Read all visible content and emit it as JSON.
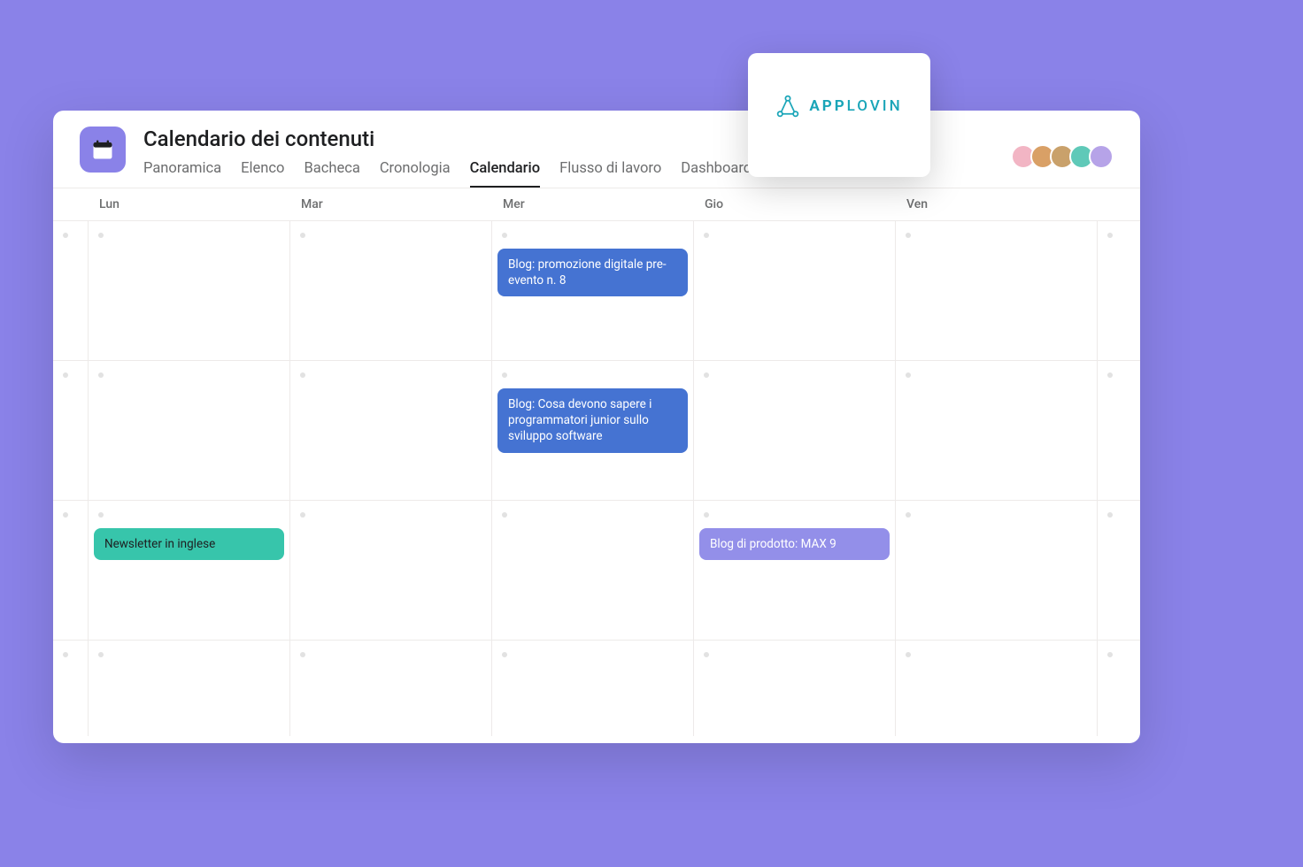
{
  "project": {
    "title": "Calendario dei contenuti"
  },
  "tabs": {
    "panoramica": "Panoramica",
    "elenco": "Elenco",
    "bacheca": "Bacheca",
    "cronologia": "Cronologia",
    "calendario": "Calendario",
    "flusso": "Flusso di lavoro",
    "dashboard": "Dashboard"
  },
  "days": {
    "lun": "Lun",
    "mar": "Mar",
    "mer": "Mer",
    "gio": "Gio",
    "ven": "Ven"
  },
  "tasks": {
    "blog_promo": "Blog: promozione digitale pre-evento n. 8",
    "blog_junior": "Blog: Cosa devono sapere i programmatori junior sullo sviluppo software",
    "newsletter": "Newsletter in inglese",
    "blog_max9": "Blog di prodotto: MAX 9"
  },
  "logo": {
    "brand_bold": "APP",
    "brand_light": "LOVIN"
  },
  "avatars": [
    {
      "bg": "#f2b5c4"
    },
    {
      "bg": "#d9a066"
    },
    {
      "bg": "#c9a16b"
    },
    {
      "bg": "#5fc9b8"
    },
    {
      "bg": "#b6a3e8"
    }
  ],
  "colors": {
    "background": "#8a82e8",
    "task_blue": "#4573d2",
    "task_teal": "#37c5ab",
    "task_purple": "#938fe9",
    "logo_teal": "#1aa5b8"
  }
}
